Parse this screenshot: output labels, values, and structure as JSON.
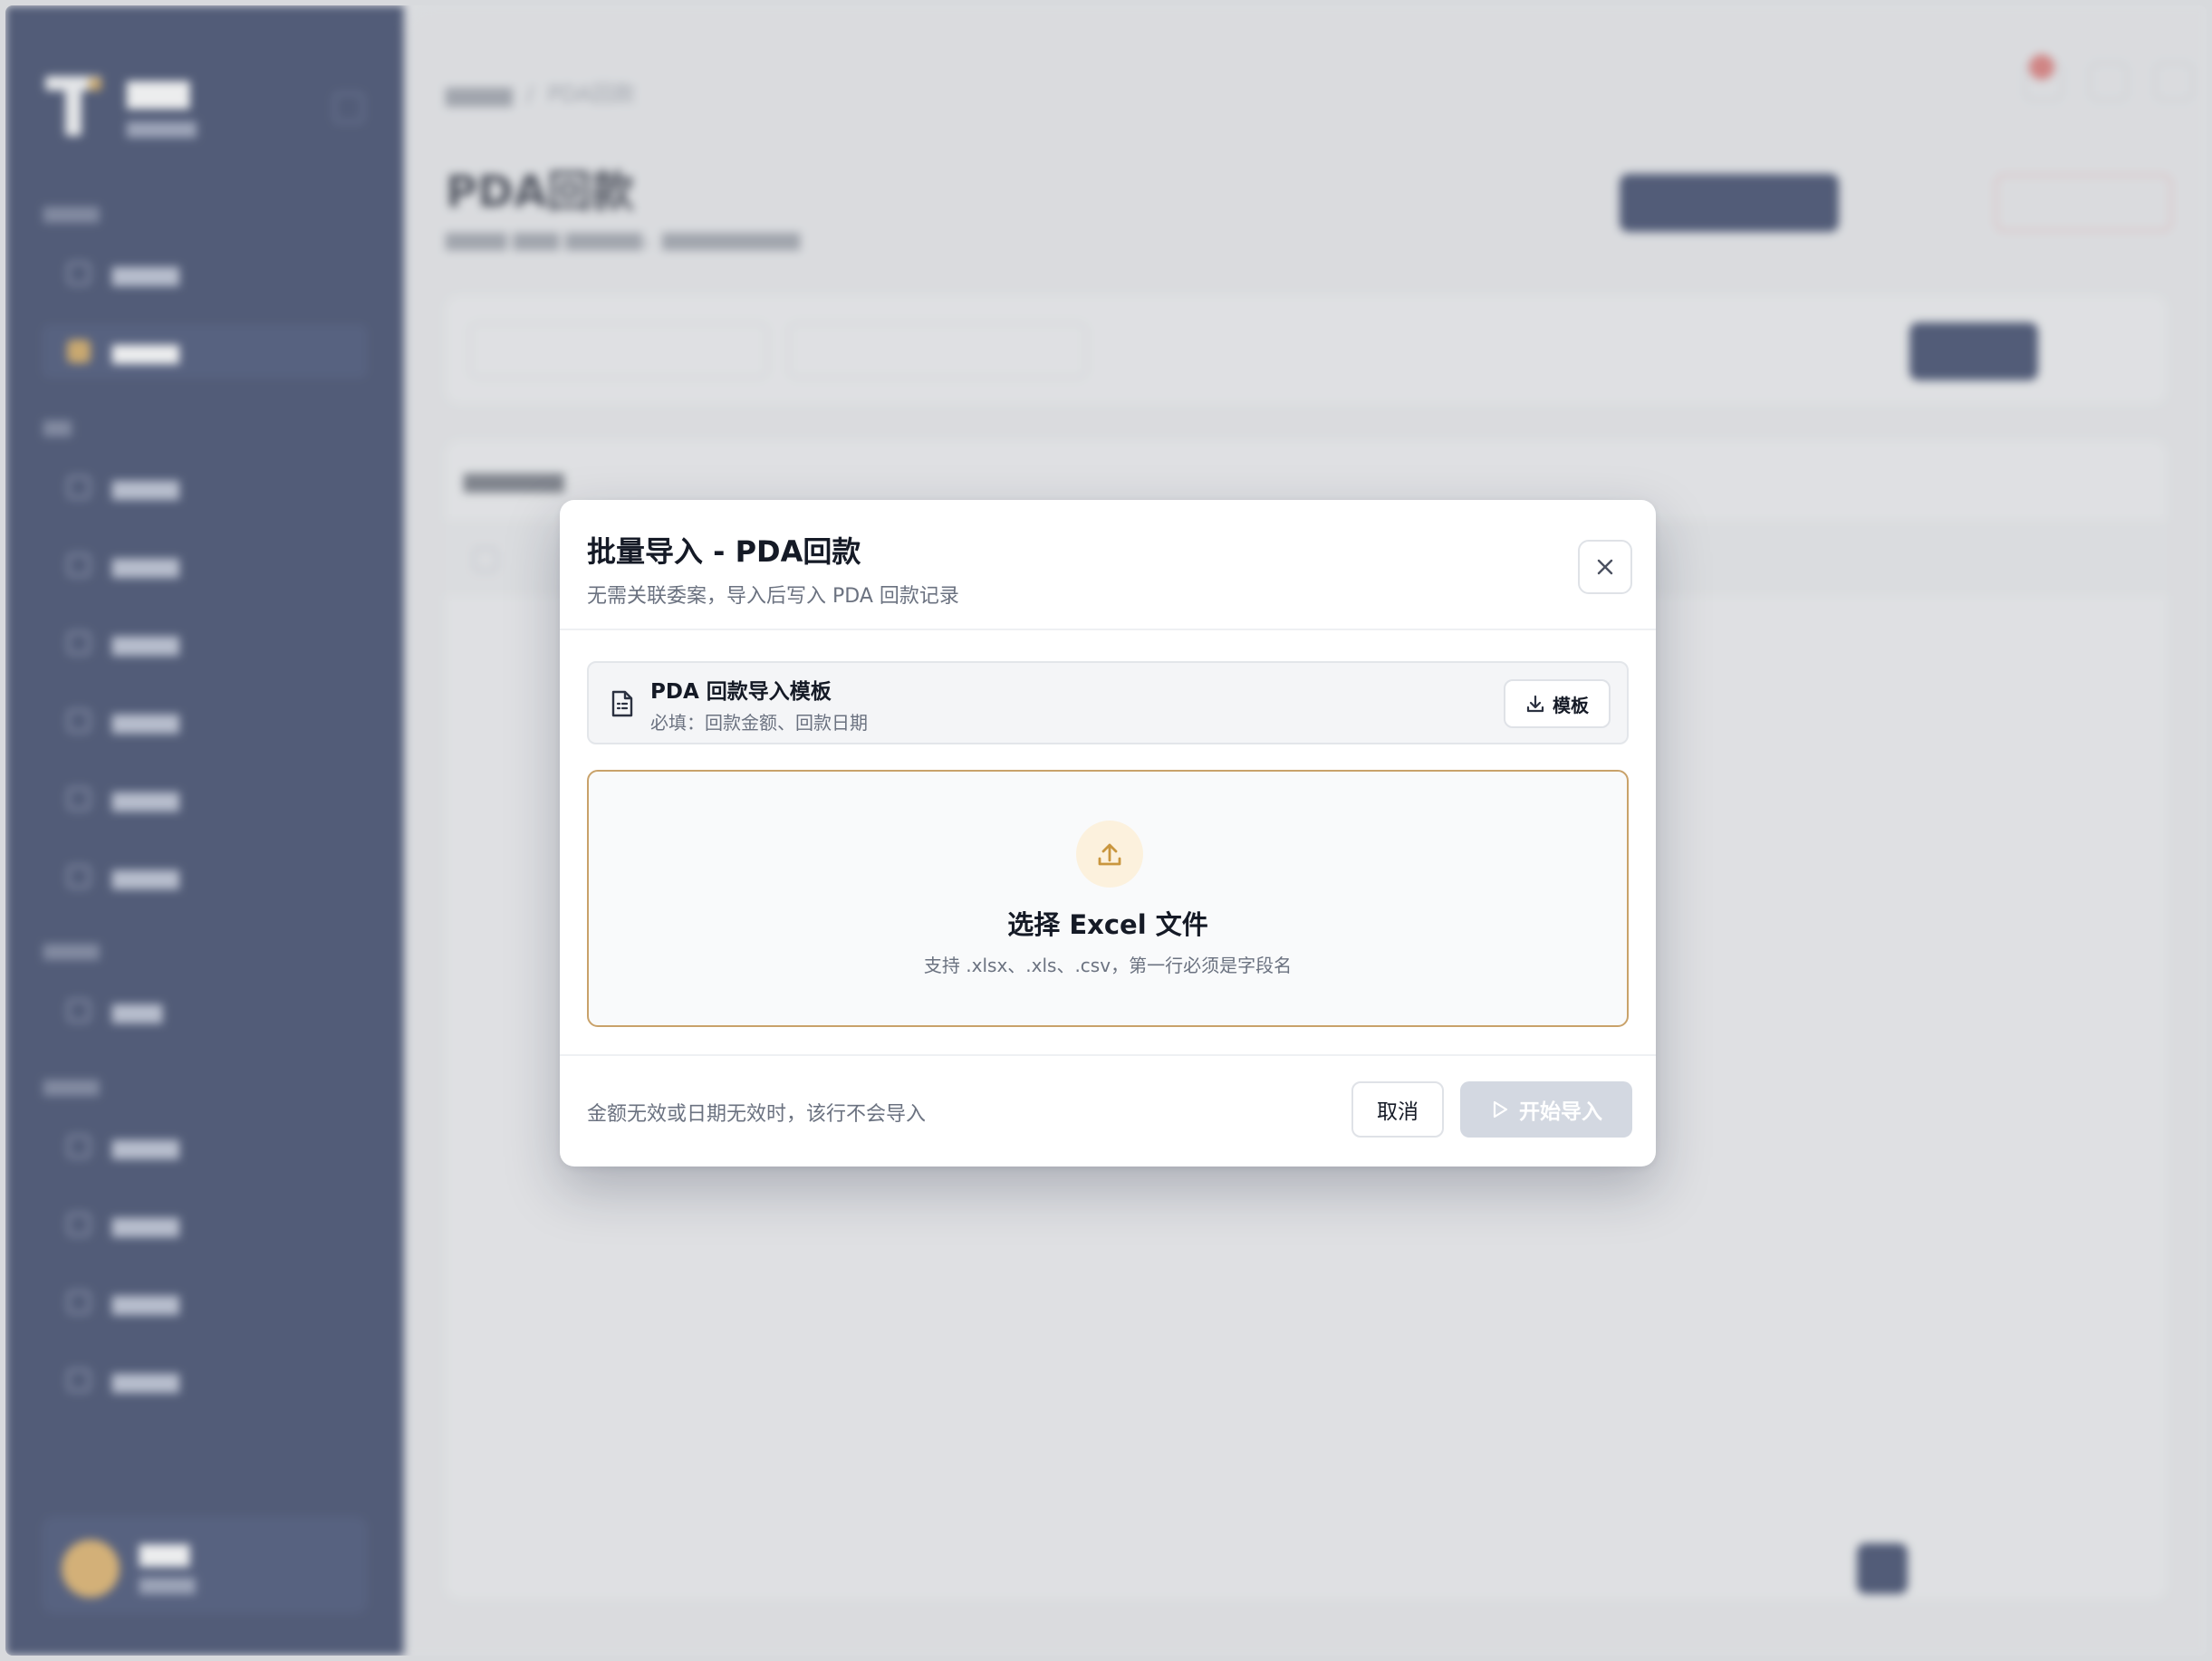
{
  "modal": {
    "title": "批量导入 - PDA回款",
    "subtitle": "无需关联委案，导入后写入 PDA 回款记录",
    "template": {
      "name": "PDA 回款导入模板",
      "required": "必填：回款金额、回款日期",
      "button_label": "模板"
    },
    "dropzone": {
      "title": "选择 Excel 文件",
      "hint": "支持 .xlsx、.xls、.csv，第一行必须是字段名"
    },
    "footer_note": "金额无效或日期无效时，该行不会导入",
    "cancel_label": "取消",
    "start_label": "开始导入",
    "start_disabled": true
  },
  "background": {
    "page_title": "PDA回款",
    "breadcrumb_current": "PDA回款"
  },
  "colors": {
    "sidebar": "#13214a",
    "accent_gold": "#c9a26a",
    "primary_navy": "#13214a",
    "disabled_button": "#d3d8e1"
  }
}
